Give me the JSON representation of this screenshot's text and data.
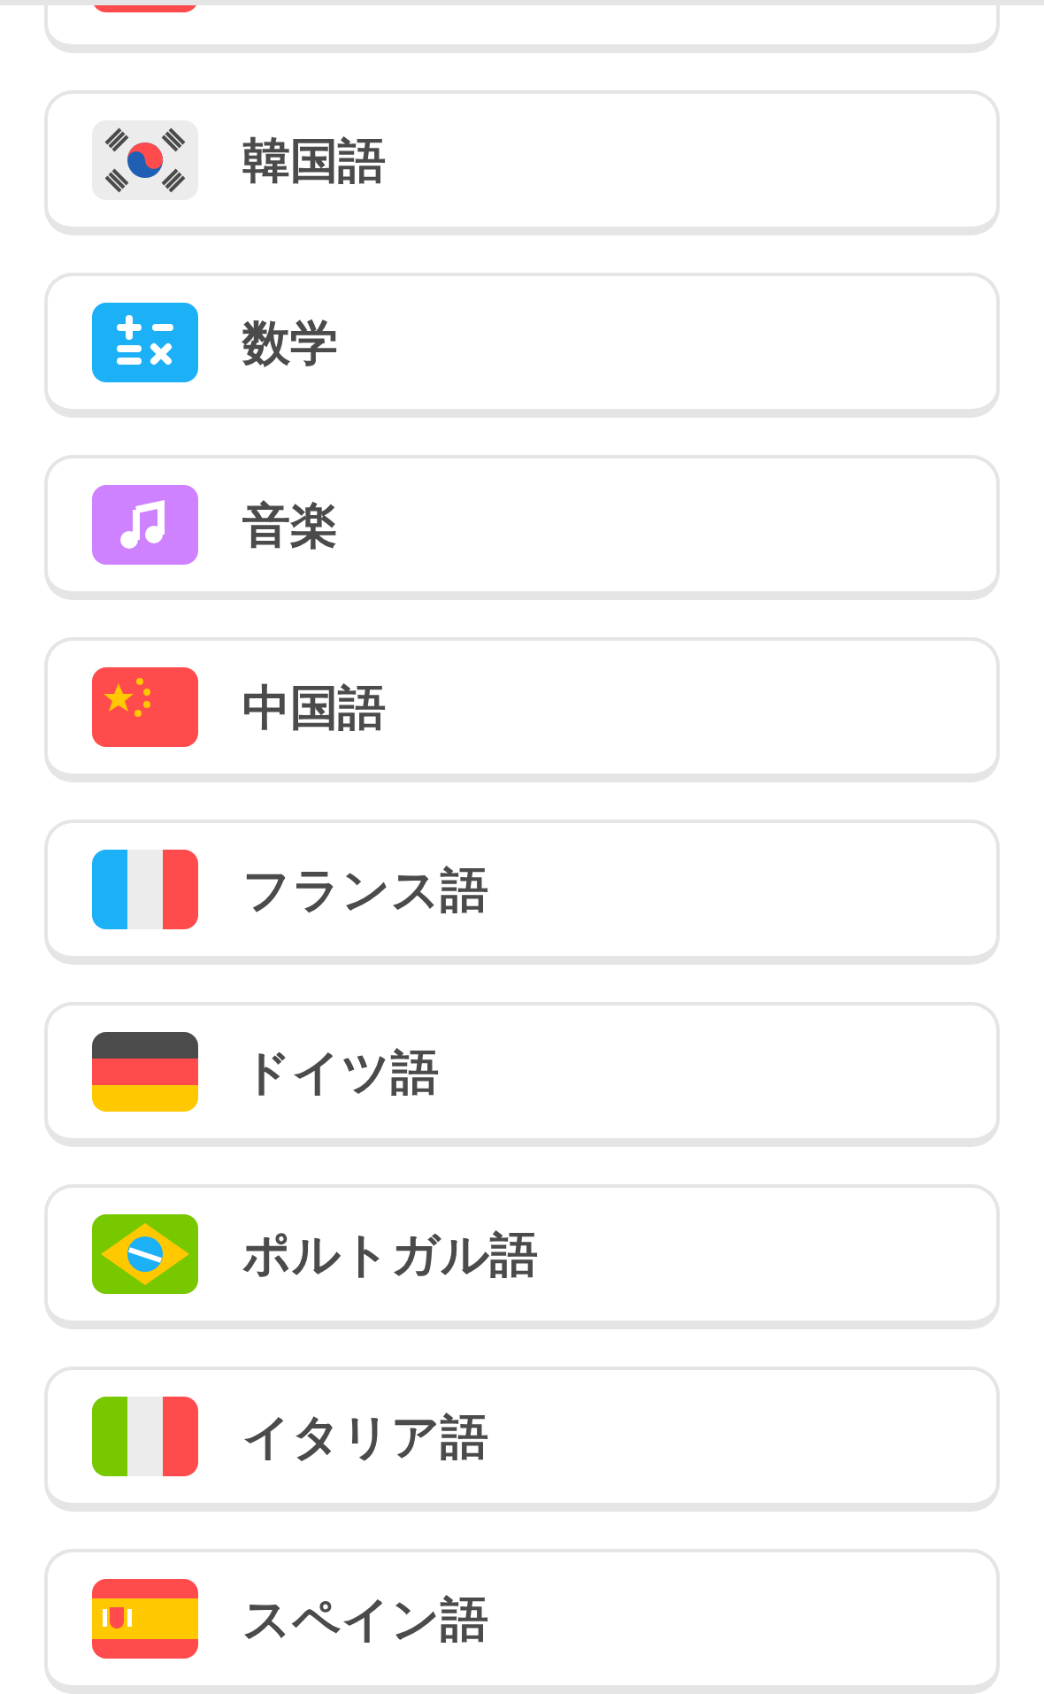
{
  "courses": [
    {
      "label": "韓国語",
      "kind": "korea"
    },
    {
      "label": "数学",
      "kind": "math"
    },
    {
      "label": "音楽",
      "kind": "music"
    },
    {
      "label": "中国語",
      "kind": "china"
    },
    {
      "label": "フランス語",
      "kind": "france"
    },
    {
      "label": "ドイツ語",
      "kind": "germany"
    },
    {
      "label": "ポルトガル語",
      "kind": "brazil"
    },
    {
      "label": "イタリア語",
      "kind": "italy"
    },
    {
      "label": "スペイン語",
      "kind": "spain"
    }
  ]
}
